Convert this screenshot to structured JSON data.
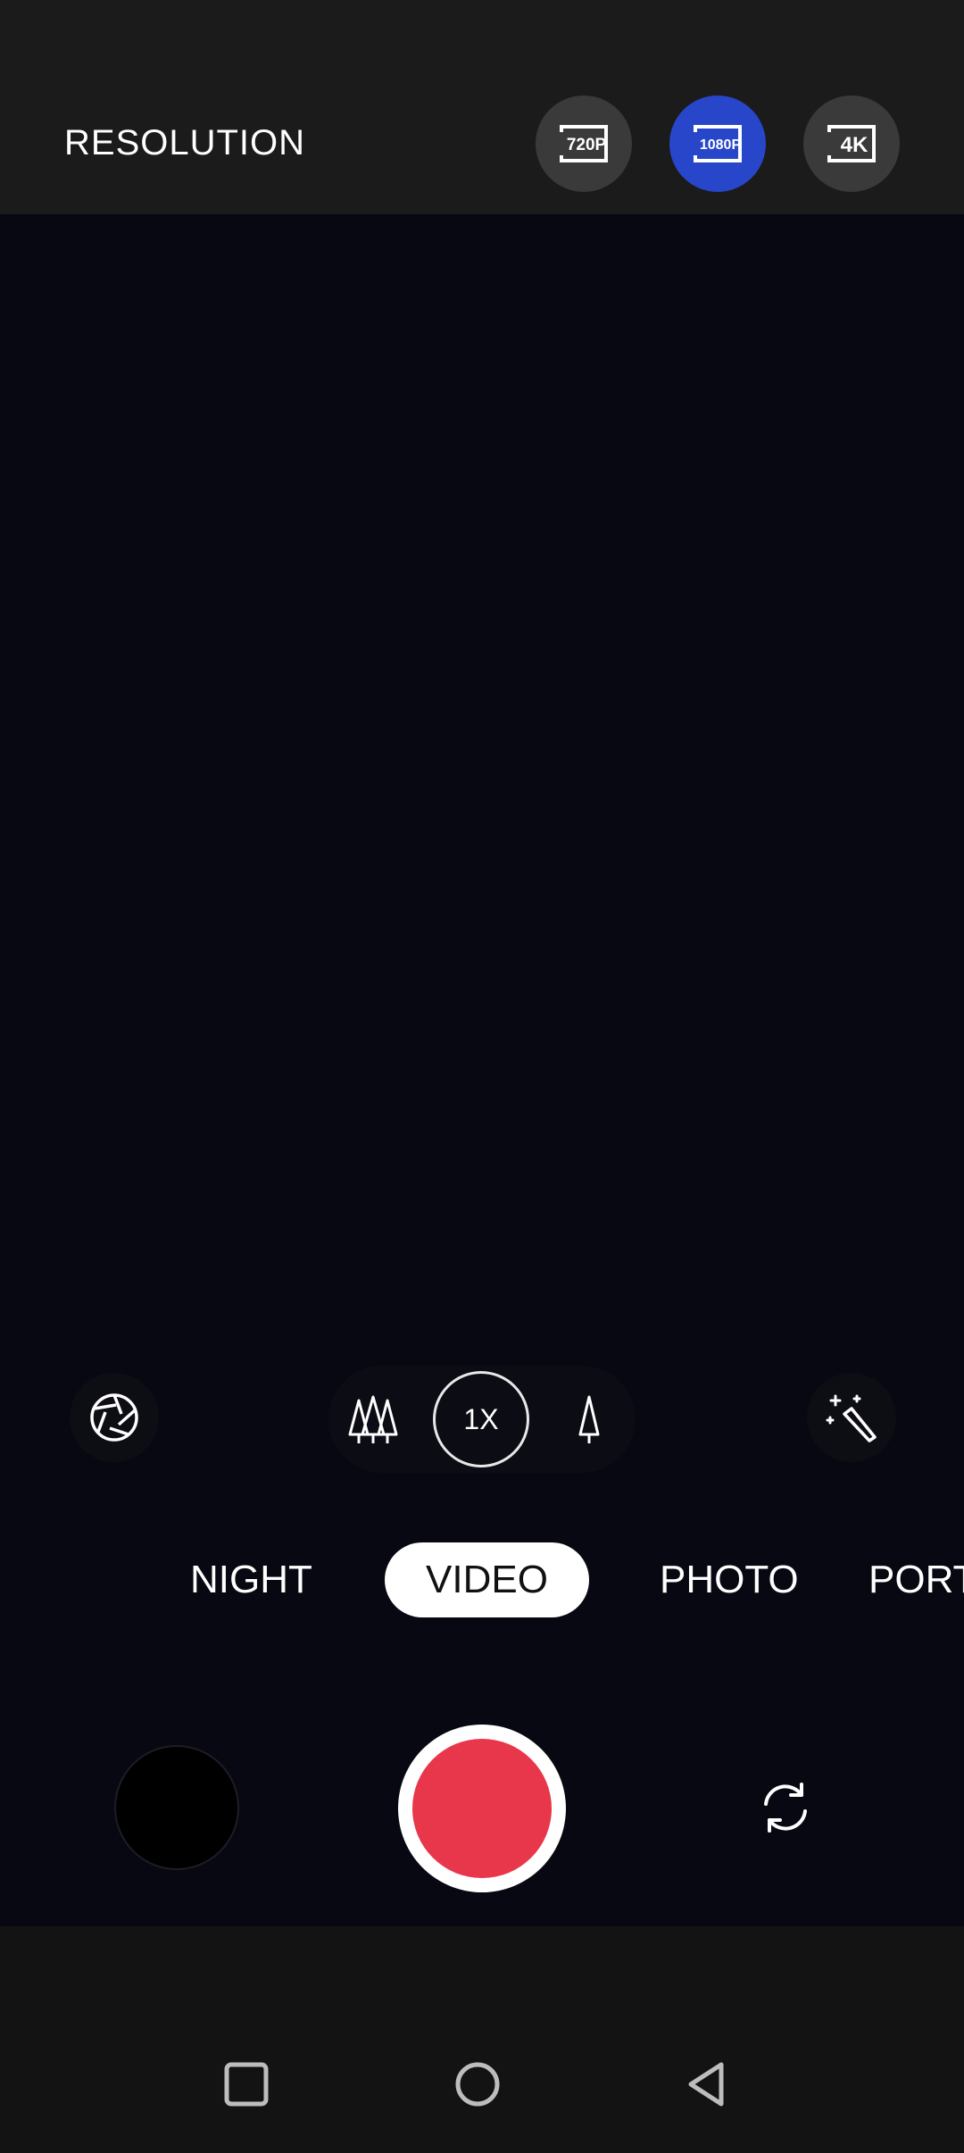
{
  "header": {
    "title": "RESOLUTION",
    "options": [
      {
        "label": "720P",
        "icon": "resolution-720p-icon",
        "selected": false
      },
      {
        "label": "1080P",
        "icon": "resolution-1080p-icon",
        "selected": true
      },
      {
        "label": "4K",
        "icon": "resolution-4k-icon",
        "selected": false
      }
    ],
    "selected_color": "#2746c9"
  },
  "controls": {
    "left_icon": "aperture-icon",
    "right_icon": "magic-wand-icon",
    "zoom_wide_icon": "trees-wide-icon",
    "zoom_tele_icon": "single-tree-tele-icon",
    "zoom_label": "1X"
  },
  "modes": {
    "items": [
      "NIGHT",
      "VIDEO",
      "PHOTO",
      "PORT"
    ],
    "active": "VIDEO"
  },
  "capture": {
    "shutter_color": "#e8364b",
    "thumbnail": "gallery-thumbnail",
    "switch_icon": "switch-camera-icon"
  },
  "navigation": {
    "buttons": [
      "recents-icon",
      "home-icon",
      "back-icon"
    ]
  }
}
